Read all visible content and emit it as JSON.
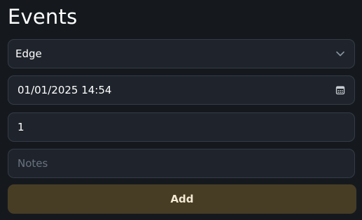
{
  "page": {
    "title": "Events"
  },
  "form": {
    "event_type": {
      "selected": "Edge",
      "icon": "chevron-down-icon"
    },
    "datetime": {
      "value": "01/01/2025 14:54",
      "icon": "calendar-icon"
    },
    "quantity": {
      "value": "1"
    },
    "notes": {
      "value": "",
      "placeholder": "Notes"
    },
    "add_label": "Add"
  },
  "colors": {
    "background": "#15191e",
    "field_background": "#1f242c",
    "field_border": "#343c47",
    "button_background": "#473d25",
    "button_text": "#f3ead4",
    "placeholder_text": "#6a7380"
  }
}
